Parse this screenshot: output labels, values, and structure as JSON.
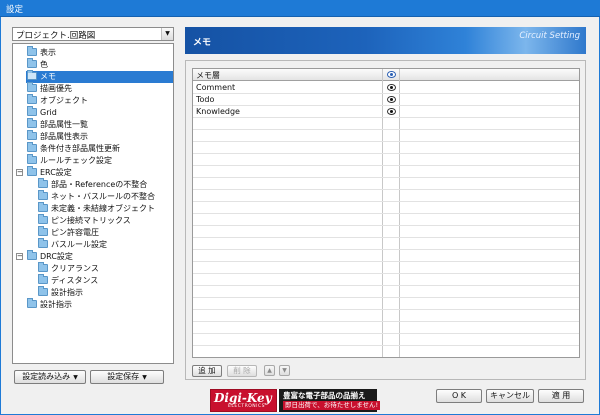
{
  "window": {
    "title": "設定"
  },
  "project": {
    "selected": "プロジェクト.回路図"
  },
  "tree": [
    {
      "label": "表示"
    },
    {
      "label": "色"
    },
    {
      "label": "メモ"
    },
    {
      "label": "描画優先"
    },
    {
      "label": "オブジェクト"
    },
    {
      "label": "Grid"
    },
    {
      "label": "部品属性一覧"
    },
    {
      "label": "部品属性表示"
    },
    {
      "label": "条件付き部品属性更新"
    },
    {
      "label": "ルールチェック設定"
    },
    {
      "label": "ERC設定"
    },
    {
      "label": "部品・Referenceの不整合"
    },
    {
      "label": "ネット・バスルールの不整合"
    },
    {
      "label": "未定義・未結線オブジェクト"
    },
    {
      "label": "ピン接続マトリックス"
    },
    {
      "label": "ピン許容電圧"
    },
    {
      "label": "バスルール設定"
    },
    {
      "label": "DRC設定"
    },
    {
      "label": "クリアランス"
    },
    {
      "label": "ディスタンス"
    },
    {
      "label": "設計指示"
    },
    {
      "label": "設計指示"
    }
  ],
  "buttons": {
    "load": "設定読み込み",
    "save": "設定保存",
    "ok": "O K",
    "cancel": "キャンセル",
    "apply": "適 用",
    "add": "追 加",
    "delete": "削 除"
  },
  "banner": {
    "title": "メモ",
    "subtitle": "Circuit Setting"
  },
  "grid": {
    "column_name": "メモ層",
    "rows": [
      {
        "name": "Comment"
      },
      {
        "name": "Todo"
      },
      {
        "name": "Knowledge"
      }
    ]
  },
  "ad": {
    "brand": "Digi-Key",
    "brand_tag": "ELECTRONICS",
    "line1": "豊富な電子部品の品揃え",
    "line2": "即日出荷で、お待たせしません!"
  },
  "colors": {
    "accent": "#2a7bd2",
    "titlebar": "#1e7ad6",
    "ad_red": "#c8102e"
  },
  "icons": {
    "tree_item": "folder-icon",
    "visibility": "eye-icon",
    "move_up": "arrow-up-icon",
    "move_down": "arrow-down-icon"
  }
}
